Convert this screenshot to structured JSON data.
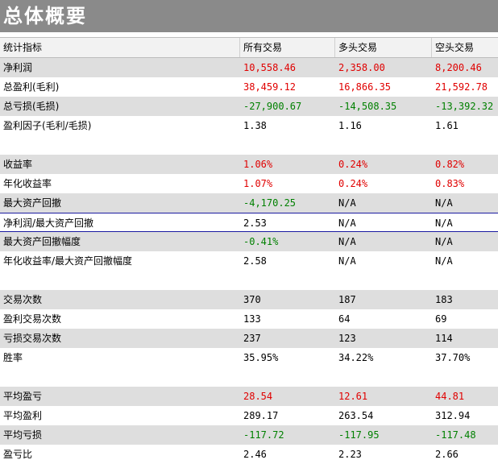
{
  "title": "总体概要",
  "header": {
    "col0": "统计指标",
    "col1": "所有交易",
    "col2": "多头交易",
    "col3": "空头交易"
  },
  "colors": {
    "positive": "#e00000",
    "negative": "#008000",
    "neutral": "#000000"
  },
  "rows": [
    {
      "label": "净利润",
      "v1": "10,558.46",
      "v2": "2,358.00",
      "v3": "8,200.46",
      "color": "red",
      "shade": "shaded"
    },
    {
      "label": "总盈利(毛利)",
      "v1": "38,459.12",
      "v2": "16,866.35",
      "v3": "21,592.78",
      "color": "red",
      "shade": "white"
    },
    {
      "label": "总亏损(毛损)",
      "v1": "-27,900.67",
      "v2": "-14,508.35",
      "v3": "-13,392.32",
      "color": "green",
      "shade": "shaded"
    },
    {
      "label": "盈利因子(毛利/毛损)",
      "v1": "1.38",
      "v2": "1.16",
      "v3": "1.61",
      "color": "black",
      "shade": "white"
    },
    {
      "label": "",
      "v1": "",
      "v2": "",
      "v3": "",
      "color": "black",
      "shade": "white"
    },
    {
      "label": "收益率",
      "v1": "1.06%",
      "v2": "0.24%",
      "v3": "0.82%",
      "color": "red",
      "shade": "shaded"
    },
    {
      "label": "年化收益率",
      "v1": "1.07%",
      "v2": "0.24%",
      "v3": "0.83%",
      "color": "red",
      "shade": "white"
    },
    {
      "label": "最大资产回撤",
      "v1": "-4,170.25",
      "v2": "N/A",
      "v3": "N/A",
      "color": "green",
      "shade": "shaded"
    },
    {
      "label": "净利润/最大资产回撤",
      "v1": "2.53",
      "v2": "N/A",
      "v3": "N/A",
      "color": "black",
      "shade": "white"
    },
    {
      "label": "最大资产回撤幅度",
      "v1": "-0.41%",
      "v2": "N/A",
      "v3": "N/A",
      "color": "green",
      "shade": "shaded"
    },
    {
      "label": "年化收益率/最大资产回撤幅度",
      "v1": "2.58",
      "v2": "N/A",
      "v3": "N/A",
      "color": "black",
      "shade": "white"
    },
    {
      "label": "",
      "v1": "",
      "v2": "",
      "v3": "",
      "color": "black",
      "shade": "white"
    },
    {
      "label": "交易次数",
      "v1": "370",
      "v2": "187",
      "v3": "183",
      "color": "black",
      "shade": "shaded"
    },
    {
      "label": "盈利交易次数",
      "v1": "133",
      "v2": "64",
      "v3": "69",
      "color": "black",
      "shade": "white"
    },
    {
      "label": "亏损交易次数",
      "v1": "237",
      "v2": "123",
      "v3": "114",
      "color": "black",
      "shade": "shaded"
    },
    {
      "label": "胜率",
      "v1": "35.95%",
      "v2": "34.22%",
      "v3": "37.70%",
      "color": "black",
      "shade": "white"
    },
    {
      "label": "",
      "v1": "",
      "v2": "",
      "v3": "",
      "color": "black",
      "shade": "white"
    },
    {
      "label": "平均盈亏",
      "v1": "28.54",
      "v2": "12.61",
      "v3": "44.81",
      "color": "red",
      "shade": "shaded"
    },
    {
      "label": "平均盈利",
      "v1": "289.17",
      "v2": "263.54",
      "v3": "312.94",
      "color": "black",
      "shade": "white"
    },
    {
      "label": "平均亏损",
      "v1": "-117.72",
      "v2": "-117.95",
      "v3": "-117.48",
      "color": "green",
      "shade": "shaded"
    },
    {
      "label": "盈亏比",
      "v1": "2.46",
      "v2": "2.23",
      "v3": "2.66",
      "color": "black",
      "shade": "white"
    }
  ]
}
